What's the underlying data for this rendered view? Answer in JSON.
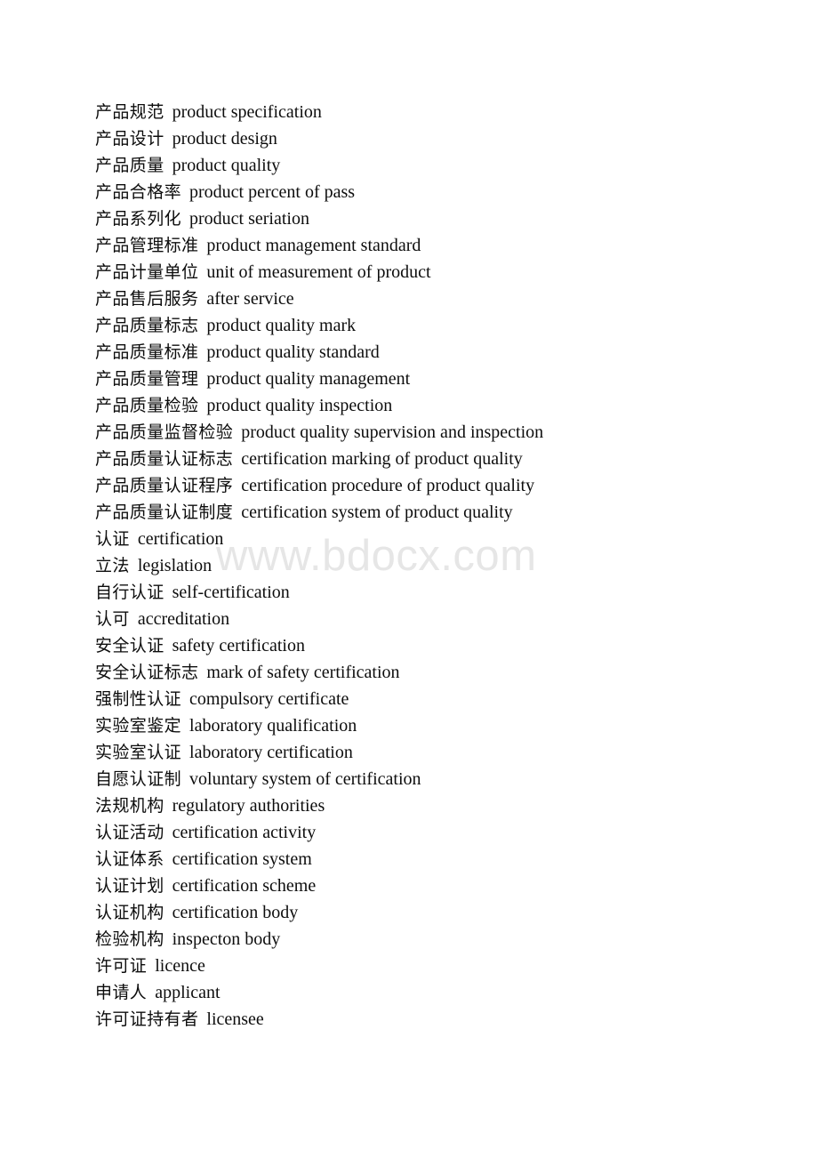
{
  "document": {
    "kind": "bilingual-glossary-page",
    "page_background": "#ffffff",
    "text_color": "#0d0d0d"
  },
  "watermark": {
    "text": "www.bdocx.com",
    "color": "#e6e6e6"
  },
  "glossary": {
    "entries": [
      {
        "zh": "产品规范",
        "en": "product specification"
      },
      {
        "zh": "产品设计",
        "en": "product design"
      },
      {
        "zh": "产品质量",
        "en": "product quality"
      },
      {
        "zh": "产品合格率",
        "en": "product percent of pass"
      },
      {
        "zh": "产品系列化",
        "en": "product seriation"
      },
      {
        "zh": "产品管理标准",
        "en": "product management standard"
      },
      {
        "zh": "产品计量单位",
        "en": "unit of measurement of product"
      },
      {
        "zh": "产品售后服务",
        "en": "after service"
      },
      {
        "zh": "产品质量标志",
        "en": "product quality mark"
      },
      {
        "zh": "产品质量标准",
        "en": "product quality standard"
      },
      {
        "zh": "产品质量管理",
        "en": "product quality management"
      },
      {
        "zh": "产品质量检验",
        "en": "product quality inspection"
      },
      {
        "zh": "产品质量监督检验",
        "en": "product quality supervision and inspection"
      },
      {
        "zh": "产品质量认证标志",
        "en": "certification marking of product quality"
      },
      {
        "zh": "产品质量认证程序",
        "en": "certification procedure of product quality"
      },
      {
        "zh": "产品质量认证制度",
        "en": "certification system of product quality"
      },
      {
        "zh": "认证",
        "en": "certification"
      },
      {
        "zh": "立法",
        "en": "legislation"
      },
      {
        "zh": "自行认证",
        "en": "self-certification"
      },
      {
        "zh": "认可",
        "en": "accreditation"
      },
      {
        "zh": "安全认证",
        "en": "safety certification"
      },
      {
        "zh": "安全认证标志",
        "en": "mark of safety certification"
      },
      {
        "zh": "强制性认证",
        "en": "compulsory certificate"
      },
      {
        "zh": "实验室鉴定",
        "en": "laboratory qualification"
      },
      {
        "zh": "实验室认证",
        "en": "laboratory certification"
      },
      {
        "zh": "自愿认证制",
        "en": "voluntary system of certification"
      },
      {
        "zh": "法规机构",
        "en": "regulatory authorities"
      },
      {
        "zh": "认证活动",
        "en": "certification activity"
      },
      {
        "zh": "认证体系",
        "en": "certification system"
      },
      {
        "zh": "认证计划",
        "en": "certification scheme"
      },
      {
        "zh": "认证机构",
        "en": "certification body"
      },
      {
        "zh": "检验机构",
        "en": "inspecton body"
      },
      {
        "zh": "许可证",
        "en": "licence"
      },
      {
        "zh": "申请人",
        "en": "applicant"
      },
      {
        "zh": "许可证持有者",
        "en": "licensee"
      }
    ]
  }
}
